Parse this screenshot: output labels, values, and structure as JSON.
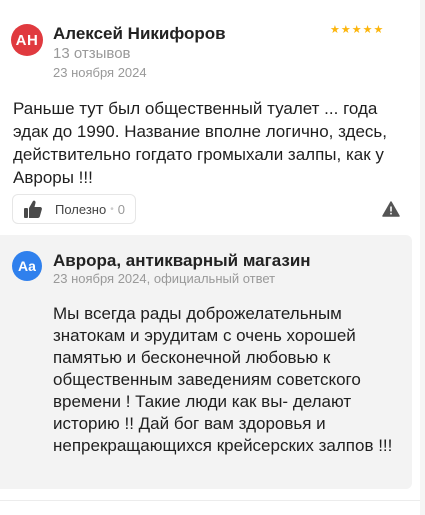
{
  "review": {
    "avatar_initials": "АН",
    "avatar_color": "#e03a3f",
    "author_name": "Алексей Никифоров",
    "author_meta": "13 отзывов",
    "date": "23 ноября 2024",
    "rating": 5,
    "stars_text": "★★★★★",
    "star_color": "#fcb50c",
    "text": "Раньше тут был общественный туалет ... года эдак до 1990. Название вполне логично, здесь, действительно гогдато громыхали залпы, как у Авроры !!!",
    "like_label": "Полезно",
    "like_count": "0",
    "icons": {
      "like": "thumb-up-icon",
      "report": "warning-icon"
    }
  },
  "reply": {
    "avatar_initials": "Aa",
    "avatar_color": "#2f80ed",
    "author_name": "Аврора, антикварный магазин",
    "meta": "23 ноября 2024, официальный ответ",
    "text": "Мы всегда рады доброжелательным знатокам и эрудитам с очень хорошей памятью и бесконечной любовью к общественным заведениям советского времени ! Такие люди как вы- делают историю !! Дай бог вам здоровья и непрекращающихся крейсерских залпов !!!"
  }
}
